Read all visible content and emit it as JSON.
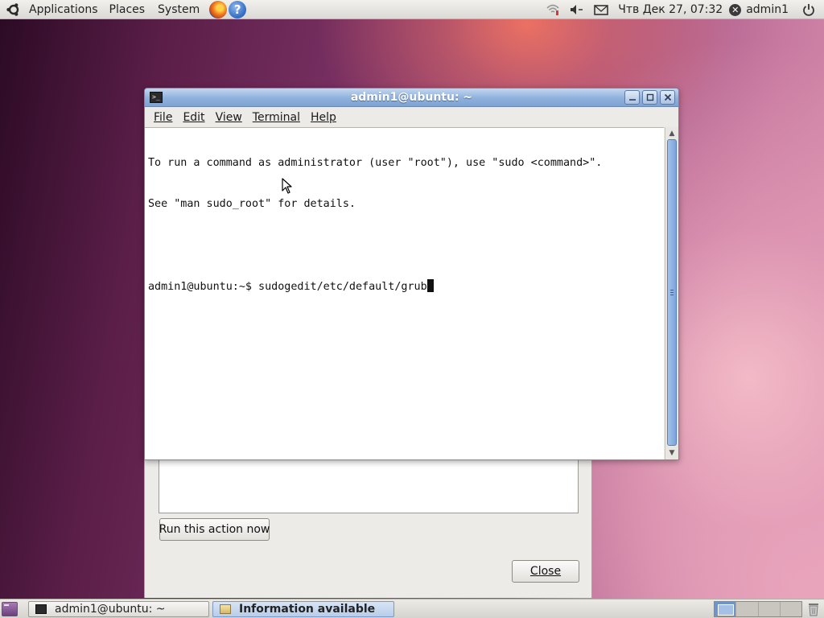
{
  "top_panel": {
    "menus": [
      "Applications",
      "Places",
      "System"
    ],
    "clock": "Чтв Дек 27, 07:32",
    "user": "admin1"
  },
  "terminal": {
    "title": "admin1@ubuntu: ~",
    "menu": [
      "File",
      "Edit",
      "View",
      "Terminal",
      "Help"
    ],
    "lines": [
      "To run a command as administrator (user \"root\"), use \"sudo <command>\".",
      "See \"man sudo_root\" for details.",
      "",
      "admin1@ubuntu:~$ sudogedit/etc/default/grub"
    ]
  },
  "dialog": {
    "run_button": "Run this action now",
    "close_button": "Close"
  },
  "taskbar": {
    "tasks": [
      "admin1@ubuntu: ~",
      "Information available"
    ]
  },
  "colors": {
    "titlebar": "#8fb0db",
    "active_task": "#b8cde9"
  },
  "icons": {
    "ubuntu": "ubuntu-logo-icon",
    "firefox": "firefox-icon",
    "help": "help-icon",
    "network": "network-icon",
    "volume": "volume-icon",
    "mail": "mail-icon",
    "power": "power-icon",
    "trash": "trash-icon"
  }
}
